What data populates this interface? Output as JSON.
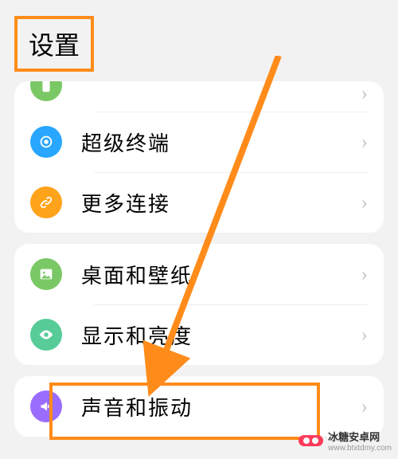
{
  "header": {
    "title": "设置"
  },
  "groups": [
    {
      "rows": [
        {
          "label": "",
          "icon": "phone-icon",
          "color": "#7ac865"
        },
        {
          "label": "超级终端",
          "icon": "target-icon",
          "color": "#29a6ff"
        },
        {
          "label": "更多连接",
          "icon": "link-icon",
          "color": "#ffa31a"
        }
      ]
    },
    {
      "rows": [
        {
          "label": "桌面和壁纸",
          "icon": "image-icon",
          "color": "#7ac865"
        },
        {
          "label": "显示和亮度",
          "icon": "eye-icon",
          "color": "#57cc99"
        }
      ]
    },
    {
      "rows": [
        {
          "label": "声音和振动",
          "icon": "volume-icon",
          "color": "#9b6dff"
        }
      ]
    }
  ],
  "watermark": {
    "brand": "冰糖安卓网",
    "url": "www.btxtdmy.com"
  }
}
